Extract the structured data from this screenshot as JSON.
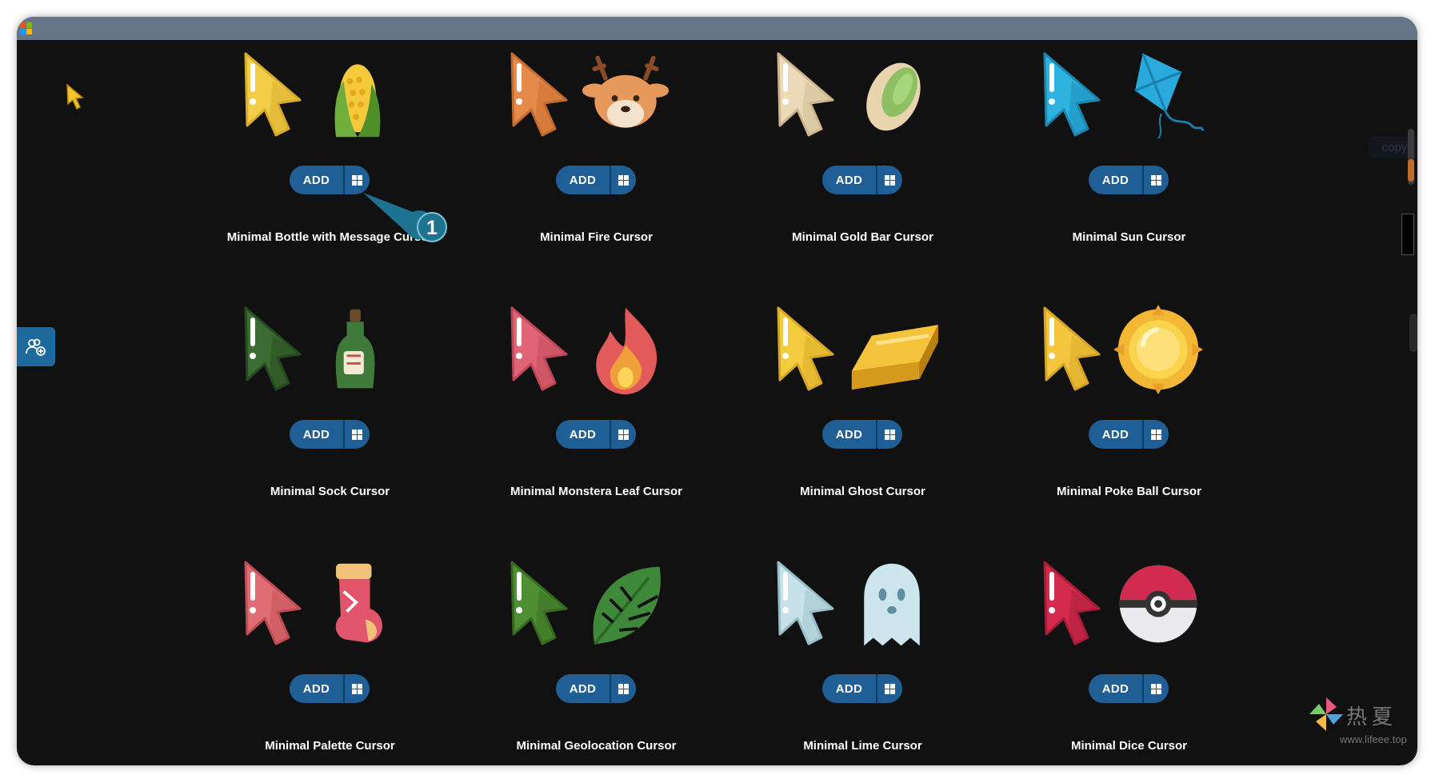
{
  "window": {
    "logo": "microsoft-logo"
  },
  "sidebar": {
    "tab_icon": "user-add-icon"
  },
  "callout": {
    "number": "1"
  },
  "overlay": {
    "copy_label": "copy"
  },
  "watermark": {
    "text": "热夏",
    "url": "www.lifeee.top"
  },
  "cards": [
    {
      "title": "Minimal Bottle with Message Cursor",
      "add_label": "ADD",
      "cursor_color": "#f2cd48",
      "cursor_shade": "#d8ab2b",
      "item": "corn"
    },
    {
      "title": "Minimal Fire Cursor",
      "add_label": "ADD",
      "cursor_color": "#e48a4a",
      "cursor_shade": "#c46b2e",
      "item": "deer"
    },
    {
      "title": "Minimal Gold Bar Cursor",
      "add_label": "ADD",
      "cursor_color": "#ecd9b8",
      "cursor_shade": "#cdb68f",
      "item": "pistachio"
    },
    {
      "title": "Minimal Sun Cursor",
      "add_label": "ADD",
      "cursor_color": "#2db3e0",
      "cursor_shade": "#1b86b0",
      "item": "kite"
    },
    {
      "title": "Minimal Sock Cursor",
      "add_label": "ADD",
      "cursor_color": "#3c6b33",
      "cursor_shade": "#264a20",
      "item": "bottle"
    },
    {
      "title": "Minimal Monstera Leaf Cursor",
      "add_label": "ADD",
      "cursor_color": "#e06474",
      "cursor_shade": "#bf4757",
      "item": "fire"
    },
    {
      "title": "Minimal Ghost Cursor",
      "add_label": "ADD",
      "cursor_color": "#f3cb3e",
      "cursor_shade": "#d6a726",
      "item": "gold-bar"
    },
    {
      "title": "Minimal Poke Ball Cursor",
      "add_label": "ADD",
      "cursor_color": "#f3c63e",
      "cursor_shade": "#d6a326",
      "item": "sun"
    },
    {
      "title": "Minimal Palette Cursor",
      "add_label": "ADD",
      "cursor_color": "#e06d74",
      "cursor_shade": "#bf4d56",
      "item": "sock"
    },
    {
      "title": "Minimal Geolocation Cursor",
      "add_label": "ADD",
      "cursor_color": "#4f8f34",
      "cursor_shade": "#356a20",
      "item": "monstera-leaf"
    },
    {
      "title": "Minimal Lime Cursor",
      "add_label": "ADD",
      "cursor_color": "#c6e2e8",
      "cursor_shade": "#98bfc8",
      "item": "ghost"
    },
    {
      "title": "Minimal Dice Cursor",
      "add_label": "ADD",
      "cursor_color": "#d42b4d",
      "cursor_shade": "#a81c39",
      "item": "poke-ball"
    }
  ]
}
